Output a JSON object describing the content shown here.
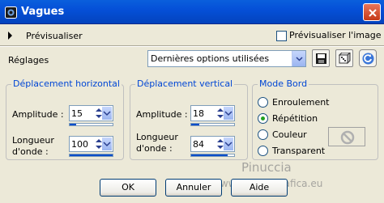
{
  "window": {
    "title": "Vagues"
  },
  "preview": {
    "label": "Prévisualiser",
    "image_label": "Prévisualiser l'image",
    "image_checked": false
  },
  "settings": {
    "label": "Réglages",
    "preset": "Dernières options utilisées"
  },
  "horizontal": {
    "title": "Déplacement horizontal",
    "amplitude_label": "Amplitude :",
    "amplitude": "15",
    "amplitude_fraction": 0.15,
    "wavelength_label_1": "Longueur",
    "wavelength_label_2": "d'onde :",
    "wavelength": "100",
    "wavelength_fraction": 1.0
  },
  "vertical": {
    "title": "Déplacement vertical",
    "amplitude_label": "Amplitude :",
    "amplitude": "18",
    "amplitude_fraction": 0.18,
    "wavelength_label_1": "Longueur",
    "wavelength_label_2": "d'onde :",
    "wavelength": "84",
    "wavelength_fraction": 0.84
  },
  "edge_mode": {
    "title": "Mode Bord",
    "options": [
      "Enroulement",
      "Répétition",
      "Couleur",
      "Transparent"
    ],
    "selected": "Répétition"
  },
  "buttons": {
    "ok": "OK",
    "cancel": "Annuler",
    "help": "Aide"
  },
  "watermark": {
    "line1": "Pinuccia",
    "line2": "www.magicagrafica.eu"
  },
  "icons": [
    "app-icon",
    "close-icon",
    "save-icon",
    "dice-icon",
    "reset-icon",
    "no-color-icon"
  ]
}
